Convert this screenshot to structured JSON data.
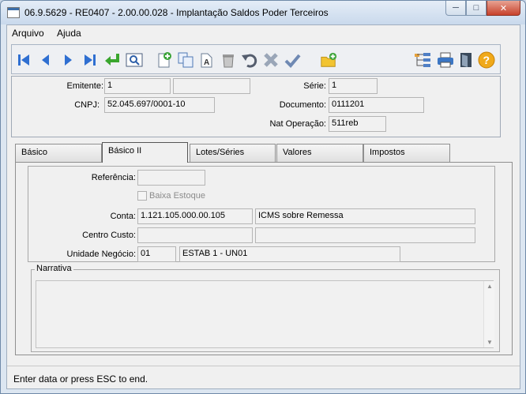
{
  "window": {
    "title": "06.9.5629 - RE0407 - 2.00.00.028 - Implantação Saldos Poder Terceiros",
    "controls": {
      "minimize": "─",
      "maximize": "□",
      "close": "✕"
    }
  },
  "menu": {
    "items": [
      "Arquivo",
      "Ajuda"
    ]
  },
  "toolbar": {
    "icons": [
      "first-record",
      "previous-record",
      "next-record",
      "last-record",
      "go-to",
      "zoom-search",
      "new-record",
      "copy-record",
      "edit-record",
      "delete-record",
      "undo",
      "cancel",
      "confirm",
      "new-folder",
      "tree-view",
      "print",
      "exit-door",
      "help"
    ]
  },
  "header": {
    "emitente_label": "Emitente:",
    "emitente_value": "1",
    "emitente_name": "",
    "cnpj_label": "CNPJ:",
    "cnpj_value": "52.045.697/0001-10",
    "serie_label": "Série:",
    "serie_value": "1",
    "documento_label": "Documento:",
    "documento_value": "0111201",
    "natop_label": "Nat Operação:",
    "natop_value": "511reb"
  },
  "tabs": [
    "Básico",
    "Básico II",
    "Lotes/Séries",
    "Valores",
    "Impostos"
  ],
  "active_tab": "Básico II",
  "form": {
    "referencia_label": "Referência:",
    "referencia_value": "",
    "baixa_label": "Baixa Estoque",
    "conta_label": "Conta:",
    "conta_value": "1.121.105.000.00.105",
    "conta_desc": "ICMS sobre Remessa",
    "centro_label": "Centro Custo:",
    "centro_value": "",
    "centro_desc": "",
    "unidade_label": "Unidade Negócio:",
    "unidade_value": "01",
    "unidade_desc": "ESTAB 1 - UN01"
  },
  "narrativa": {
    "label": "Narrativa",
    "value": ""
  },
  "status": {
    "text": "Enter data or press ESC to end."
  }
}
